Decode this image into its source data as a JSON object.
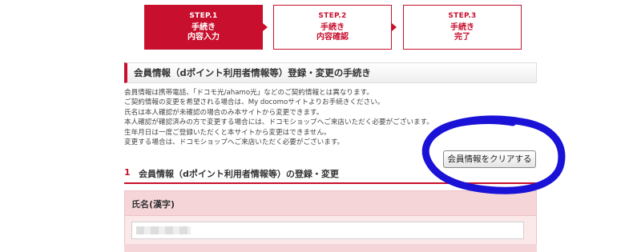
{
  "steps": [
    {
      "num": "STEP.1",
      "line1": "手続き",
      "line2": "内容入力"
    },
    {
      "num": "STEP.2",
      "line1": "手続き",
      "line2": "内容確認"
    },
    {
      "num": "STEP.3",
      "line1": "手続き",
      "line2": "完了"
    }
  ],
  "section": {
    "title": "会員情報（dポイント利用者情報等）登録・変更の手続き"
  },
  "notice": [
    "会員情報は携帯電話、「ドコモ光/ahamo光」などのご契約情報とは異なります。",
    "ご契約情報の変更を希望される場合は、My docomoサイトよりお手続きください。",
    "氏名は本人確認が未確認の場合のみ本サイトから変更できます。",
    "本人確認が確認済みの方で変更する場合には、ドコモショップへご来店いただく必要がございます。",
    "生年月日は一度ご登録いただくと本サイトから変更はできません。",
    "変更する場合は、ドコモショップへご来店いただく必要がございます。"
  ],
  "clear_button": "会員情報をクリアする",
  "subsection": {
    "number": "1",
    "title": "会員情報（dポイント利用者情報等）の登録・変更"
  },
  "form": {
    "name_label": "氏名(漢字)",
    "name_value": ""
  },
  "colors": {
    "accent": "#c8102e",
    "annotation": "#1a12d6"
  }
}
